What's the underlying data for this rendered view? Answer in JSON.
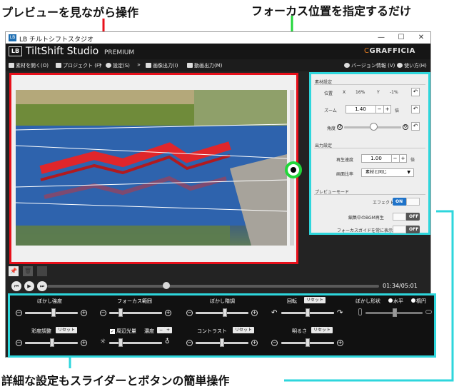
{
  "callouts": {
    "preview": "プレビューを見ながら操作",
    "focus": "フォーカス位置を指定するだけ",
    "sliders": "詳細な設定もスライダーとボタンの簡単操作"
  },
  "window": {
    "title": "LB チルトシフトスタジオ",
    "icon_text": "LB",
    "controls": [
      "—",
      "☐",
      "✕"
    ]
  },
  "brand": {
    "lb": "LB",
    "name": "TiltShift Studio",
    "edition": "PREMIUM",
    "logo_prefix": "C",
    "logo_rest": "GRAFFICIA"
  },
  "menu": {
    "open": "素材を開く(O)",
    "project": "プロジェクト (F)",
    "settings": "設定(S)",
    "image_out": "画像出力(I)",
    "video_out": "動画出力(M)",
    "version": "バージョン情報 (V)",
    "help": "使い方(H)",
    "separator": "»"
  },
  "panel": {
    "material": {
      "title": "素材設定",
      "position": "位置",
      "x_label": "X",
      "x_value": "16%",
      "y_label": "Y",
      "y_value": "-1%",
      "zoom": "ズーム",
      "zoom_value": "1.40",
      "zoom_unit": "倍",
      "angle": "角度"
    },
    "output": {
      "title": "出力設定",
      "speed": "再生速度",
      "speed_value": "1.00",
      "speed_unit": "倍",
      "aspect": "画面比率",
      "aspect_value": "素材と同じ"
    },
    "preview_mode": {
      "title": "プレビューモード",
      "effect": "エフェクト",
      "effect_state": "ON",
      "bgm": "編集中のBGM再生",
      "bgm_state": "OFF",
      "guide": "フォーカスガイドを常に表示",
      "guide_state": "OFF"
    }
  },
  "transport": {
    "time": "01:34/05:01",
    "progress": 0.36
  },
  "sliders": {
    "blur_strength": "ぼかし強度",
    "focus_range": "フォーカス範囲",
    "blur_gradient": "ぼかし階調",
    "rotation": "回転",
    "blur_shape": "ぼかし形状",
    "shape_horizontal": "水平",
    "shape_ellipse": "楕円",
    "saturation": "彩度調整",
    "vignette": "周辺光量",
    "vignette_density": "濃度",
    "contrast": "コントラスト",
    "brightness": "明るさ",
    "reset": "リセット",
    "minus": "−",
    "plus": "+"
  },
  "colors": {
    "preview_highlight": "#e8101b",
    "panel_highlight": "#2ed6dc",
    "focus_marker": "#22d63a",
    "toggle_on": "#1f73c9"
  }
}
